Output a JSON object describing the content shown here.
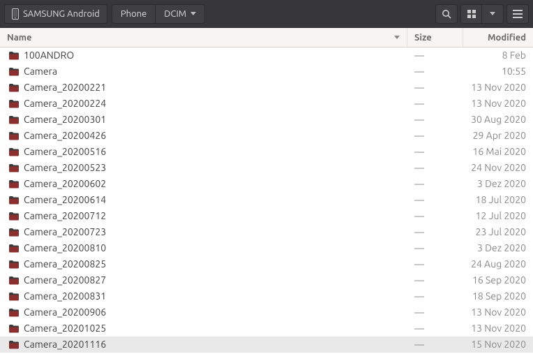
{
  "toolbar": {
    "device": "SAMSUNG Android",
    "path": [
      "Phone",
      "DCIM"
    ]
  },
  "columns": {
    "name": "Name",
    "size": "Size",
    "modified": "Modified"
  },
  "rows": [
    {
      "name": "100ANDRO",
      "size": "—",
      "modified": "8 Feb",
      "selected": false
    },
    {
      "name": "Camera",
      "size": "—",
      "modified": "10:55",
      "selected": false
    },
    {
      "name": "Camera_20200221",
      "size": "—",
      "modified": "13 Nov 2020",
      "selected": false
    },
    {
      "name": "Camera_20200224",
      "size": "—",
      "modified": "13 Nov 2020",
      "selected": false
    },
    {
      "name": "Camera_20200301",
      "size": "—",
      "modified": "30 Aug 2020",
      "selected": false
    },
    {
      "name": "Camera_20200426",
      "size": "—",
      "modified": "29 Apr 2020",
      "selected": false
    },
    {
      "name": "Camera_20200516",
      "size": "—",
      "modified": "16 Mai 2020",
      "selected": false
    },
    {
      "name": "Camera_20200523",
      "size": "—",
      "modified": "24 Nov 2020",
      "selected": false
    },
    {
      "name": "Camera_20200602",
      "size": "—",
      "modified": "3 Dez 2020",
      "selected": false
    },
    {
      "name": "Camera_20200614",
      "size": "—",
      "modified": "18 Jul 2020",
      "selected": false
    },
    {
      "name": "Camera_20200712",
      "size": "—",
      "modified": "12 Jul 2020",
      "selected": false
    },
    {
      "name": "Camera_20200723",
      "size": "—",
      "modified": "23 Jul 2020",
      "selected": false
    },
    {
      "name": "Camera_20200810",
      "size": "—",
      "modified": "3 Dez 2020",
      "selected": false
    },
    {
      "name": "Camera_20200825",
      "size": "—",
      "modified": "24 Aug 2020",
      "selected": false
    },
    {
      "name": "Camera_20200827",
      "size": "—",
      "modified": "16 Sep 2020",
      "selected": false
    },
    {
      "name": "Camera_20200831",
      "size": "—",
      "modified": "18 Sep 2020",
      "selected": false
    },
    {
      "name": "Camera_20200906",
      "size": "—",
      "modified": "13 Nov 2020",
      "selected": false
    },
    {
      "name": "Camera_20201025",
      "size": "—",
      "modified": "13 Nov 2020",
      "selected": false
    },
    {
      "name": "Camera_20201116",
      "size": "—",
      "modified": "15 Nov 2020",
      "selected": true
    }
  ]
}
